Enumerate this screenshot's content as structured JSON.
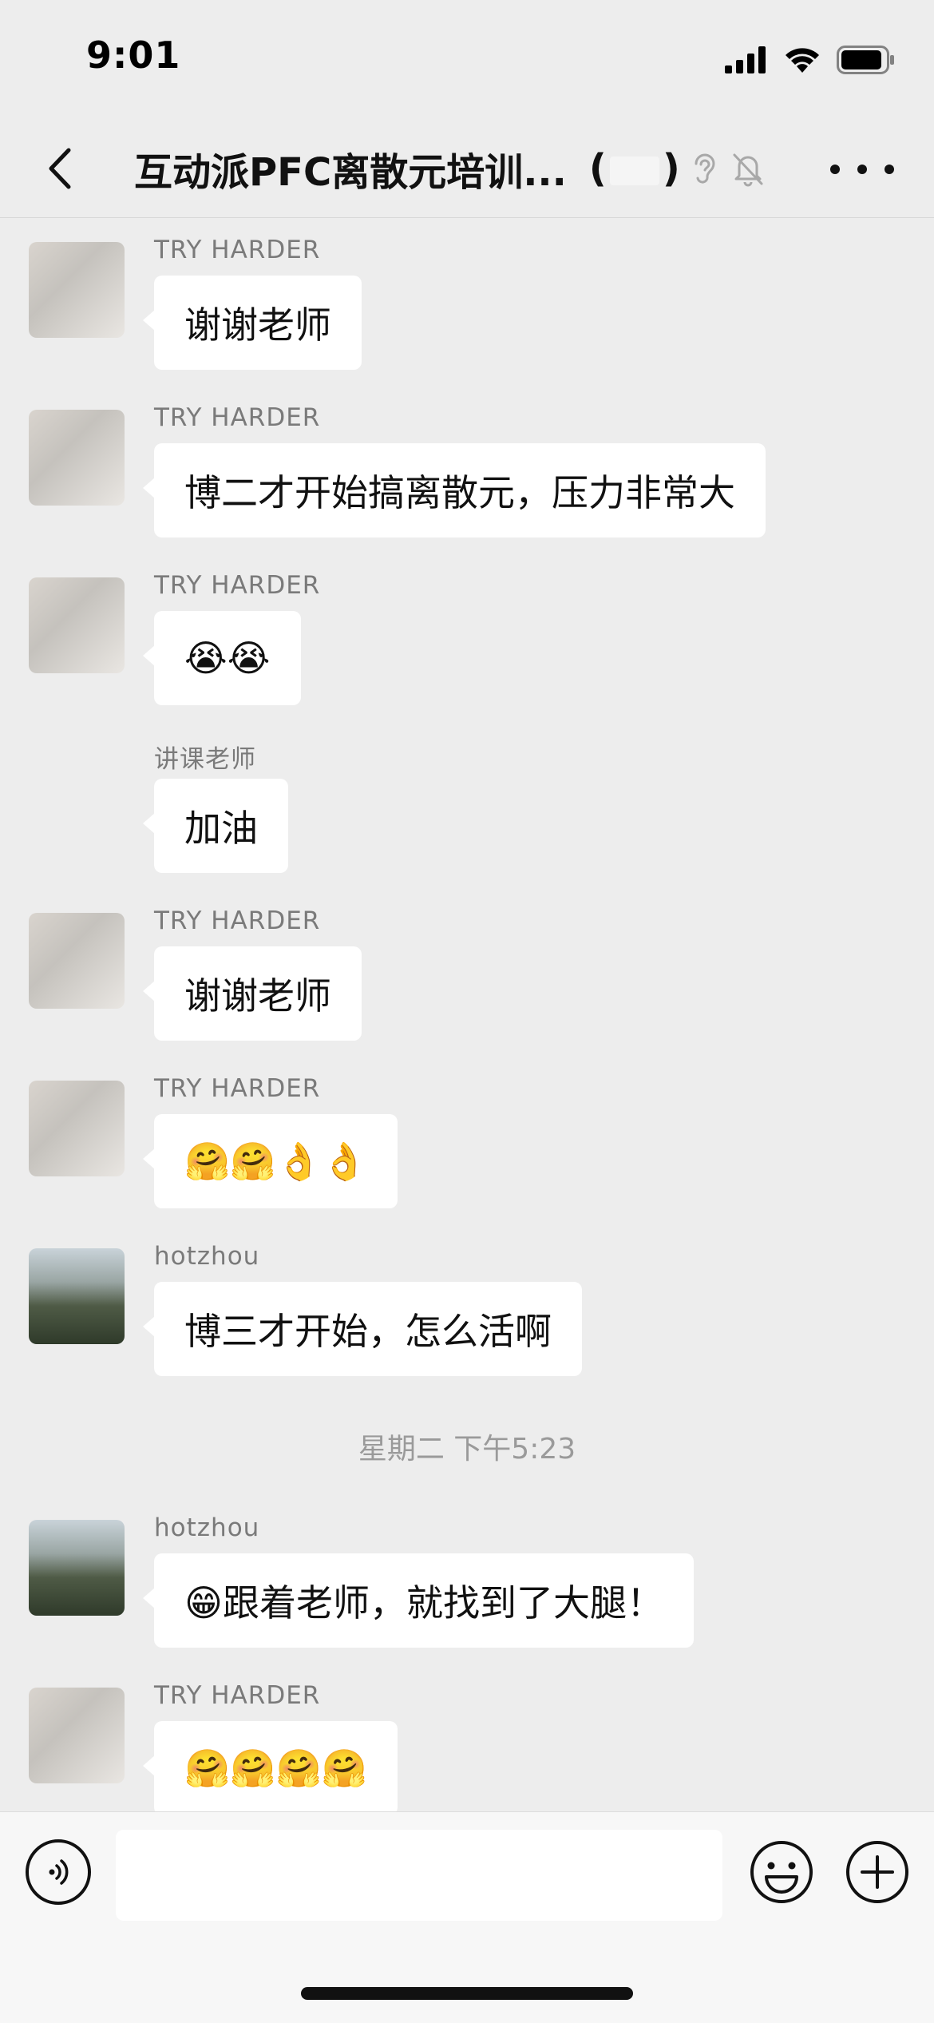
{
  "status_bar": {
    "time": "9:01"
  },
  "nav": {
    "title": "互动派PFC离散元培训...",
    "paren_open": "(",
    "paren_close": ")"
  },
  "messages": [
    {
      "sender": "TRY HARDER",
      "text": "谢谢老师",
      "avatar": "kid"
    },
    {
      "sender": "TRY HARDER",
      "text": "博二才开始搞离散元，压力非常大",
      "avatar": "kid"
    },
    {
      "sender": "TRY HARDER",
      "text": "😭😭",
      "avatar": "kid"
    },
    {
      "sender": "讲课老师",
      "text": "加油",
      "avatar": "none"
    },
    {
      "sender": "TRY HARDER",
      "text": "谢谢老师",
      "avatar": "kid"
    },
    {
      "sender": "TRY HARDER",
      "text": "🤗🤗👌👌",
      "avatar": "kid"
    },
    {
      "sender": "hotzhou",
      "text": "博三才开始，怎么活啊",
      "avatar": "landscape"
    },
    {
      "sender": "hotzhou",
      "text": "😁跟着老师，就找到了大腿！",
      "avatar": "landscape"
    },
    {
      "sender": "TRY HARDER",
      "text": "🤗🤗🤗🤗",
      "avatar": "kid"
    }
  ],
  "timestamp": "星期二 下午5:23",
  "input": {
    "placeholder": ""
  },
  "icons": {
    "back": "chevron-left-icon",
    "ear": "ear-icon",
    "mute": "bell-off-icon",
    "more": "more-icon",
    "voice": "voice-icon",
    "emoji": "emoji-icon",
    "plus": "plus-icon"
  }
}
